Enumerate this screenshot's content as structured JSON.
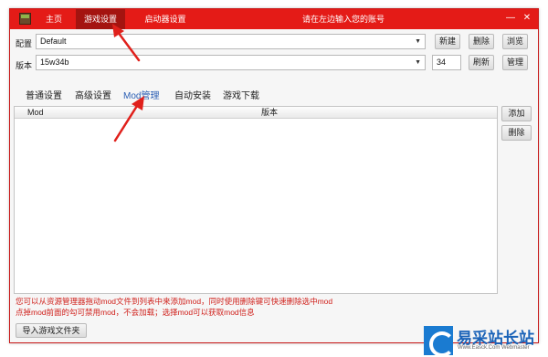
{
  "titlebar": {
    "tabs": [
      {
        "label": "主页"
      },
      {
        "label": "游戏设置"
      },
      {
        "label": "启动器设置"
      }
    ],
    "active_tab": "游戏设置",
    "title": "请在左边输入您的账号",
    "minimize": "—",
    "close": "✕"
  },
  "config": {
    "label": "配置",
    "value": "Default",
    "new_button": "新建",
    "delete_button": "删除",
    "browse_button": "浏览"
  },
  "version": {
    "label": "版本",
    "value": "15w34b",
    "number": "34",
    "refresh_button": "刷新",
    "manage_button": "管理"
  },
  "subtabs": [
    {
      "label": "普通设置"
    },
    {
      "label": "高级设置"
    },
    {
      "label": "Mod管理"
    },
    {
      "label": "自动安装"
    },
    {
      "label": "游戏下载"
    }
  ],
  "active_subtab": "Mod管理",
  "mod_table": {
    "columns": [
      "Mod",
      "版本"
    ],
    "rows": []
  },
  "side_buttons": {
    "add": "添加",
    "remove": "删除"
  },
  "hints": [
    "您可以从资源管理器拖动mod文件到列表中来添加mod，同时使用删除键可快速删除选中mod",
    "点掉mod前面的勾可禁用mod，不会加载；选择mod可以获取mod信息"
  ],
  "import_button": "导入游戏文件夹",
  "watermark": {
    "title": "易采站长站",
    "sub": "Www.Easck.Com  Webmaster"
  },
  "colors": {
    "titlebar": "#e41b17",
    "active_tab": "#a41410",
    "hint_text": "#d0211c",
    "annotation_arrow": "#e0201b",
    "active_subtab": "#2b5fb4"
  }
}
